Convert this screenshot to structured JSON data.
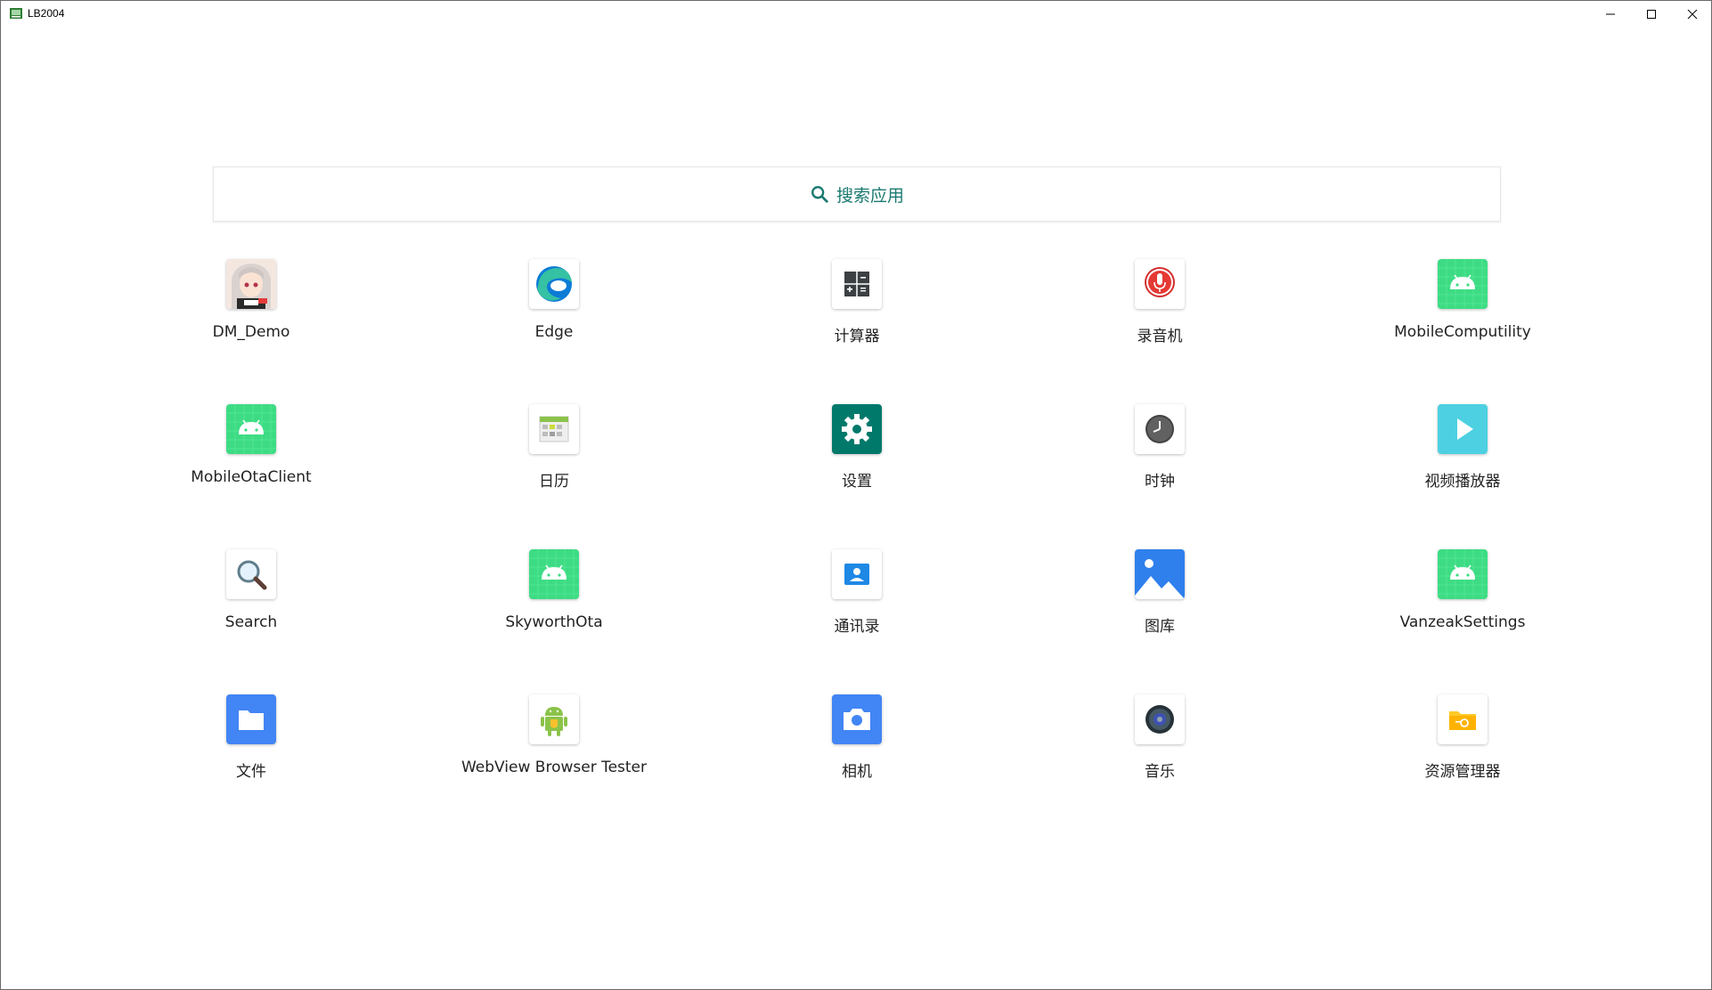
{
  "window": {
    "title": "LB2004",
    "controls": [
      "minimize",
      "maximize",
      "close"
    ]
  },
  "search": {
    "label": "搜索应用",
    "icon": "search-icon",
    "accent": "#1a7a70"
  },
  "apps": [
    {
      "label": "DM_Demo",
      "icon": "anime-avatar-icon"
    },
    {
      "label": "Edge",
      "icon": "edge-icon"
    },
    {
      "label": "计算器",
      "icon": "calculator-icon"
    },
    {
      "label": "录音机",
      "icon": "microphone-icon"
    },
    {
      "label": "MobileComputility",
      "icon": "android-icon"
    },
    {
      "label": "MobileOtaClient",
      "icon": "android-icon"
    },
    {
      "label": "日历",
      "icon": "calendar-icon"
    },
    {
      "label": "设置",
      "icon": "settings-gear-icon"
    },
    {
      "label": "时钟",
      "icon": "clock-icon"
    },
    {
      "label": "视频播放器",
      "icon": "play-icon"
    },
    {
      "label": "Search",
      "icon": "magnifier-icon"
    },
    {
      "label": "SkyworthOta",
      "icon": "android-icon"
    },
    {
      "label": "通讯录",
      "icon": "contacts-icon"
    },
    {
      "label": "图库",
      "icon": "gallery-icon"
    },
    {
      "label": "VanzeakSettings",
      "icon": "android-icon"
    },
    {
      "label": "文件",
      "icon": "folder-icon"
    },
    {
      "label": "WebView Browser Tester",
      "icon": "android-robot-icon"
    },
    {
      "label": "相机",
      "icon": "camera-icon"
    },
    {
      "label": "音乐",
      "icon": "speaker-icon"
    },
    {
      "label": "资源管理器",
      "icon": "file-manager-icon"
    }
  ]
}
